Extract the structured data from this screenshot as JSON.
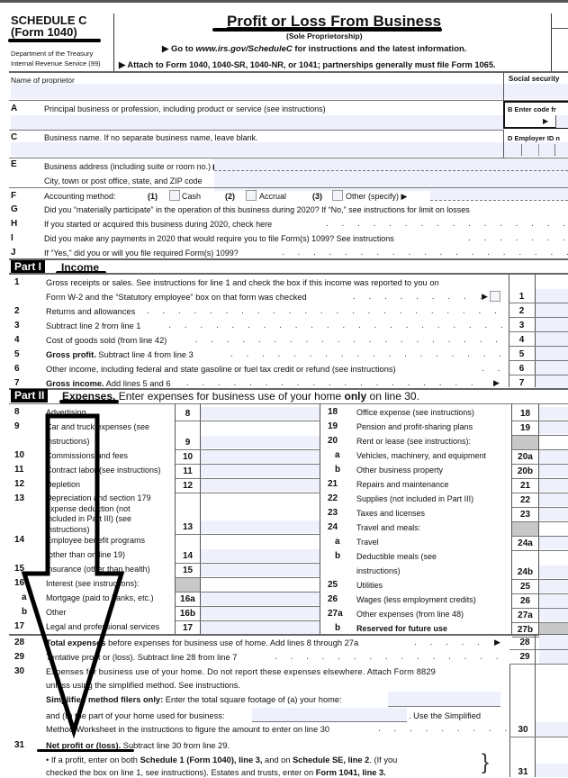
{
  "header": {
    "schedule": "SCHEDULE C",
    "form": "(Form 1040)",
    "dept1": "Department of the Treasury",
    "dept2": "Internal Revenue Service (99)",
    "title": "Profit or Loss From Business",
    "subtitle": "(Sole Proprietorship)",
    "goto_prefix": "▶ Go to ",
    "goto_url": "www.irs.gov/ScheduleC",
    "goto_suffix": " for instructions and the latest information.",
    "attach": "▶ Attach to Form 1040, 1040-SR, 1040-NR, or 1041; partnerships generally must file Form 1065."
  },
  "top": {
    "name_label": "Name of proprietor",
    "ssn_label": "Social security",
    "A_letter": "A",
    "A_label": "Principal business or profession, including product or service (see instructions)",
    "B_label": "B  Enter code fr",
    "B_arrow": "▶",
    "C_letter": "C",
    "C_label": "Business name. If no separate business name, leave blank.",
    "D_label": "D  Employer ID n",
    "E_letter": "E",
    "E_label": "Business address (including suite or room no.) ▶",
    "E_city": "City, town or post office, state, and ZIP code",
    "F_letter": "F",
    "F_label": "Accounting method:",
    "F_opt1_num": "(1)",
    "F_opt1": "Cash",
    "F_opt2_num": "(2)",
    "F_opt2": "Accrual",
    "F_opt3_num": "(3)",
    "F_opt3": "Other (specify) ▶",
    "G_letter": "G",
    "G_label": "Did you “materially participate” in the operation of this business during 2020? If “No,” see instructions for limit on losses",
    "H_letter": "H",
    "H_label": "If you started or acquired this business during 2020, check here",
    "I_letter": "I",
    "I_label": "Did you make any payments in 2020 that would require you to file Form(s) 1099? See instructions",
    "J_letter": "J",
    "J_label": "If “Yes,” did you or will you file required Form(s) 1099?"
  },
  "part1": {
    "tag": "Part I",
    "title": "Income",
    "lines": [
      {
        "num": "1",
        "text": "Gross receipts or sales. See instructions for line 1 and check the box if this income was reported to you on",
        "text2": "Form W-2 and the “Statutory employee” box on that form was checked",
        "box": "1"
      },
      {
        "num": "2",
        "text": "Returns and allowances",
        "box": "2"
      },
      {
        "num": "3",
        "text": "Subtract line 2 from line 1",
        "box": "3"
      },
      {
        "num": "4",
        "text": "Cost of goods sold (from line 42)",
        "box": "4"
      },
      {
        "num": "5",
        "bold": "Gross profit.",
        "text": " Subtract line 4 from line 3",
        "box": "5"
      },
      {
        "num": "6",
        "text": "Other income, including federal and state gasoline or fuel tax credit or refund (see instructions)",
        "box": "6"
      },
      {
        "num": "7",
        "bold": "Gross income.",
        "text": " Add lines 5 and 6",
        "box": "7"
      }
    ]
  },
  "part2": {
    "tag": "Part II",
    "title": "Expenses.",
    "desc_pre": " Enter expenses for business use of your home ",
    "desc_bold": "only",
    "desc_post": " on line 30.",
    "left": [
      {
        "num": "8",
        "text": "Advertising",
        "box": "8"
      },
      {
        "num": "9",
        "text": "Car and truck expenses (see",
        "text2": "instructions)",
        "box": "9"
      },
      {
        "num": "10",
        "text": "Commissions and fees",
        "box": "10"
      },
      {
        "num": "11",
        "text": "Contract labor (see instructions)",
        "box": "11"
      },
      {
        "num": "12",
        "text": "Depletion",
        "box": "12"
      },
      {
        "num": "13",
        "text": "Depreciation and section 179",
        "text2": "expense deduction (not",
        "text3": "included in Part III) (see",
        "text4": "instructions)",
        "box": "13"
      },
      {
        "num": "14",
        "text": "Employee benefit programs",
        "text2": "(other than on line 19)",
        "box": "14"
      },
      {
        "num": "15",
        "text": "Insurance (other than health)",
        "box": "15"
      },
      {
        "num": "16",
        "text": "Interest (see instructions):"
      },
      {
        "num": "a",
        "text": "Mortgage (paid to banks, etc.)",
        "box": "16a"
      },
      {
        "num": "b",
        "text": "Other",
        "box": "16b"
      },
      {
        "num": "17",
        "text": "Legal and professional services",
        "box": "17"
      }
    ],
    "right": [
      {
        "num": "18",
        "text": "Office expense (see instructions)",
        "box": "18"
      },
      {
        "num": "19",
        "text": "Pension and profit-sharing plans",
        "box": "19"
      },
      {
        "num": "20",
        "text": "Rent or lease (see instructions):"
      },
      {
        "num": "a",
        "text": "Vehicles, machinery, and equipment",
        "box": "20a"
      },
      {
        "num": "b",
        "text": "Other business property",
        "box": "20b"
      },
      {
        "num": "21",
        "text": "Repairs and maintenance",
        "box": "21"
      },
      {
        "num": "22",
        "text": "Supplies (not included in Part III)",
        "box": "22"
      },
      {
        "num": "23",
        "text": "Taxes and licenses",
        "box": "23"
      },
      {
        "num": "24",
        "text": "Travel and meals:"
      },
      {
        "num": "a",
        "text": "Travel",
        "box": "24a"
      },
      {
        "num": "b",
        "text": "Deductible meals (see",
        "text2": "instructions)",
        "box": "24b"
      },
      {
        "num": "25",
        "text": "Utilities",
        "box": "25"
      },
      {
        "num": "26",
        "text": "Wages (less employment credits)",
        "box": "26"
      },
      {
        "num": "27a",
        "text": "Other expenses (from line 48)",
        "box": "27a"
      },
      {
        "num": "b",
        "text": "Reserved for future use",
        "box": "27b"
      }
    ],
    "l28_num": "28",
    "l28_bold": "Total expenses",
    "l28_text": " before expenses for business use of home. Add lines 8 through 27a",
    "l28_box": "28",
    "l29_num": "29",
    "l29_text": "Tentative profit or (loss). Subtract line 28 from line 7",
    "l29_box": "29",
    "l30_num": "30",
    "l30_text": "Expenses for business use of your home. Do not report these expenses elsewhere. Attach Form 8829",
    "l30_text2": "unless using the simplified method. See instructions.",
    "l30_bold3": "Simplified method filers only:",
    "l30_text3": " Enter the total square footage of (a) your home:",
    "l30_text4": "and (b) the part of your home used for business:",
    "l30_text4b": ". Use the Simplified",
    "l30_text5": "Method Worksheet in the instructions to figure the amount to enter on line 30",
    "l30_box": "30",
    "l31_num": "31",
    "l31_bold": "Net profit or (loss).",
    "l31_text": " Subtract line 30 from line 29.",
    "l31_b1_pre": "• If a profit, enter on both ",
    "l31_b1_bold1": "Schedule 1 (Form 1040), line 3,",
    "l31_b1_mid": " and on ",
    "l31_b1_bold2": "Schedule SE, line 2",
    "l31_b1_post": ". (If you",
    "l31_b2_pre": "checked the box on line 1, see instructions). Estates and trusts, enter on ",
    "l31_b2_bold": "Form 1041, line 3.",
    "l31_box": "31"
  }
}
